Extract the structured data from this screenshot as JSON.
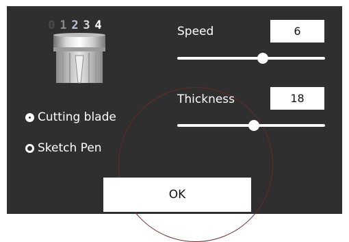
{
  "speed": {
    "label": "Speed",
    "value": "6",
    "slider_level": 0.58
  },
  "thickness": {
    "label": "Thickness",
    "value": "18",
    "slider_level": 0.52
  },
  "tool_options": [
    {
      "label": "Cutting blade",
      "selected": true
    },
    {
      "label": "Sketch Pen",
      "selected": false
    }
  ],
  "blade_dial": {
    "digits": [
      "0",
      "1",
      "2",
      "3",
      "4"
    ]
  },
  "ok_label": "OK"
}
